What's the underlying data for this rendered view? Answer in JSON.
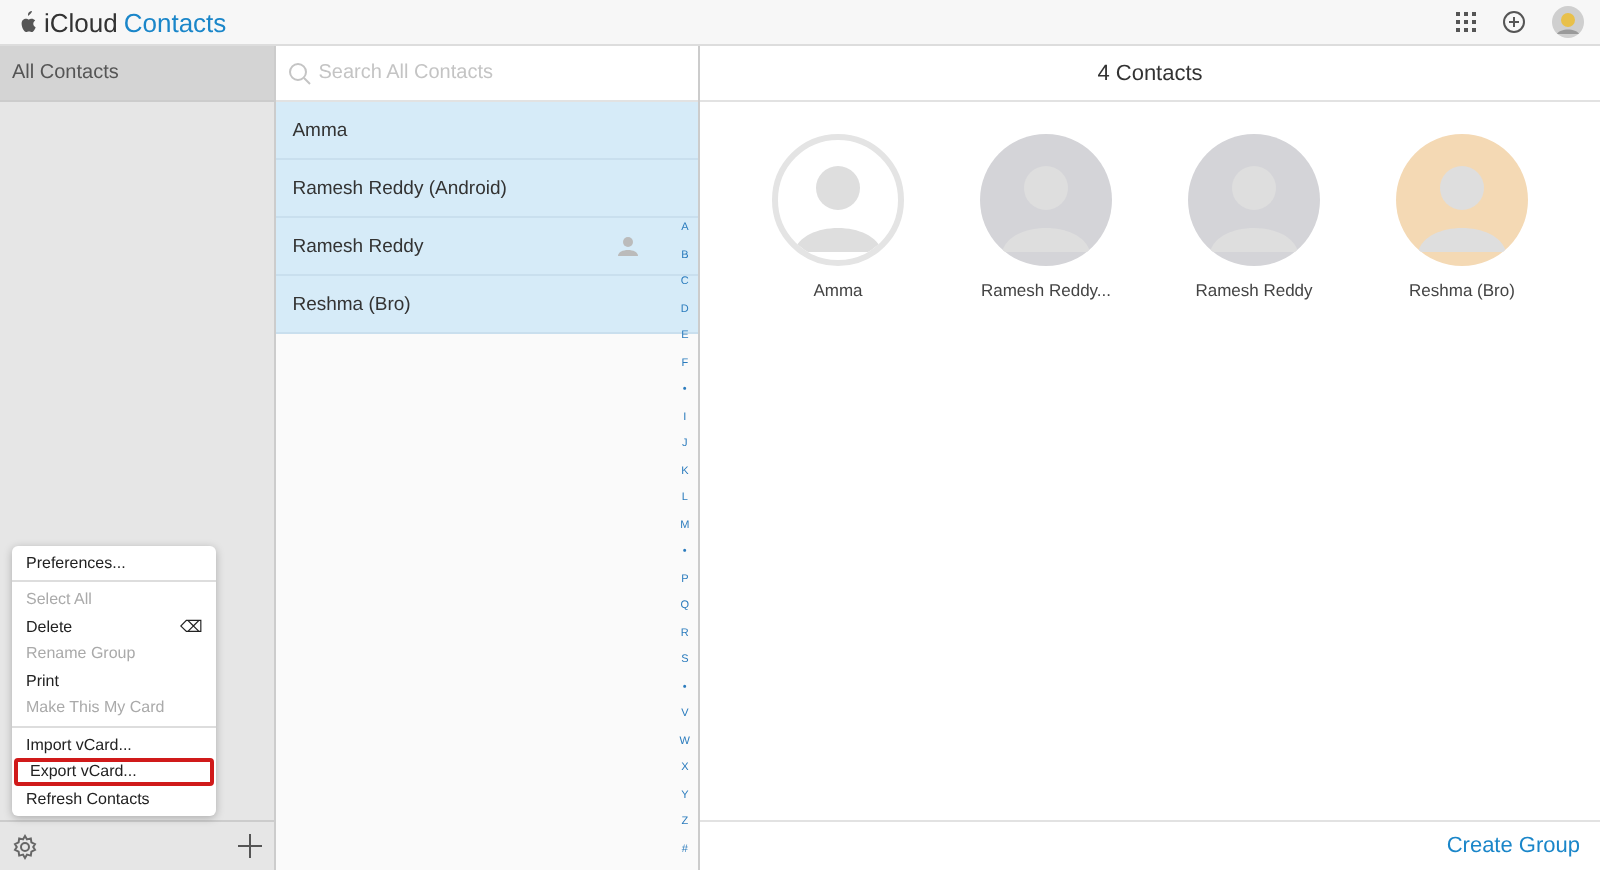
{
  "header": {
    "brand": "iCloud",
    "app": "Contacts"
  },
  "sidebar": {
    "groups": [
      {
        "label": "All Contacts",
        "selected": true
      }
    ]
  },
  "menu": {
    "sections": [
      {
        "items": [
          {
            "label": "Preferences...",
            "disabled": false,
            "highlighted": false
          }
        ]
      },
      {
        "items": [
          {
            "label": "Select All",
            "disabled": true,
            "highlighted": false
          },
          {
            "label": "Delete",
            "disabled": false,
            "highlighted": false,
            "shortcut": "⌫"
          },
          {
            "label": "Rename Group",
            "disabled": true,
            "highlighted": false
          },
          {
            "label": "Print",
            "disabled": false,
            "highlighted": false
          },
          {
            "label": "Make This My Card",
            "disabled": true,
            "highlighted": false
          }
        ]
      },
      {
        "items": [
          {
            "label": "Import vCard...",
            "disabled": false,
            "highlighted": false
          },
          {
            "label": "Export vCard...",
            "disabled": false,
            "highlighted": true
          },
          {
            "label": "Refresh Contacts",
            "disabled": false,
            "highlighted": false
          }
        ]
      }
    ]
  },
  "search": {
    "placeholder": "Search All Contacts"
  },
  "contacts": [
    {
      "name": "Amma",
      "selected": true,
      "me_card": false
    },
    {
      "name": "Ramesh Reddy (Android)",
      "selected": true,
      "me_card": false
    },
    {
      "name": "Ramesh Reddy",
      "selected": true,
      "me_card": true
    },
    {
      "name": "Reshma (Bro)",
      "selected": true,
      "me_card": false
    }
  ],
  "index_letters": [
    "A",
    "B",
    "C",
    "D",
    "E",
    "F",
    "•",
    "I",
    "J",
    "K",
    "L",
    "M",
    "•",
    "P",
    "Q",
    "R",
    "S",
    "•",
    "V",
    "W",
    "X",
    "Y",
    "Z",
    "#"
  ],
  "cards_title": "4 Contacts",
  "cards": [
    {
      "name": "Amma",
      "color": "#ffffff"
    },
    {
      "name": "Ramesh Reddy...",
      "color": "#d4d4d8"
    },
    {
      "name": "Ramesh Reddy",
      "color": "#d4d4d8"
    },
    {
      "name": "Reshma (Bro)",
      "color": "#f4d9b4"
    }
  ],
  "create_group": "Create Group"
}
